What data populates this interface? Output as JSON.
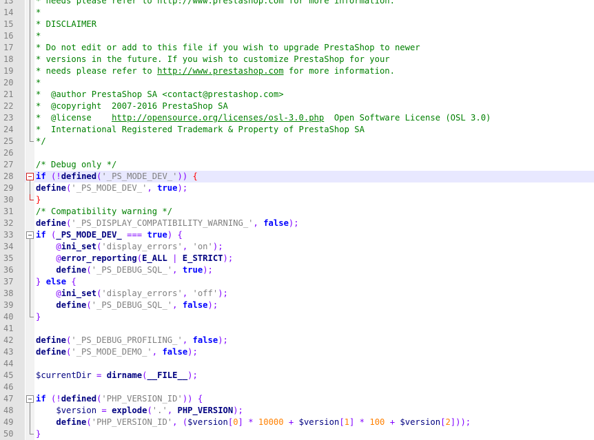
{
  "editor": {
    "current_line": "28",
    "lines": [
      {
        "num": "13",
        "fold": "v",
        "t": [
          [
            "c",
            "* needs please refer to http://www.prestashop.com for more information."
          ]
        ]
      },
      {
        "num": "14",
        "fold": "v",
        "t": [
          [
            "c",
            "*"
          ]
        ]
      },
      {
        "num": "15",
        "fold": "v",
        "t": [
          [
            "c",
            "* DISCLAIMER"
          ]
        ]
      },
      {
        "num": "16",
        "fold": "v",
        "t": [
          [
            "c",
            "*"
          ]
        ]
      },
      {
        "num": "17",
        "fold": "v",
        "t": [
          [
            "c",
            "* Do not edit or add to this file if you wish to upgrade PrestaShop to newer"
          ]
        ]
      },
      {
        "num": "18",
        "fold": "v",
        "t": [
          [
            "c",
            "* versions in the future. If you wish to customize PrestaShop for your"
          ]
        ]
      },
      {
        "num": "19",
        "fold": "v",
        "t": [
          [
            "c",
            "* needs please refer to "
          ],
          [
            "lnk",
            "http://www.prestashop.com"
          ],
          [
            "c",
            " for more information."
          ]
        ]
      },
      {
        "num": "20",
        "fold": "v",
        "t": [
          [
            "c",
            "*"
          ]
        ]
      },
      {
        "num": "21",
        "fold": "v",
        "t": [
          [
            "c",
            "*  @author PrestaShop SA <contact@prestashop.com>"
          ]
        ]
      },
      {
        "num": "22",
        "fold": "v",
        "t": [
          [
            "c",
            "*  @copyright  2007-2016 PrestaShop SA"
          ]
        ]
      },
      {
        "num": "23",
        "fold": "v",
        "t": [
          [
            "c",
            "*  @license    "
          ],
          [
            "lnk",
            "http://opensource.org/licenses/osl-3.0.php"
          ],
          [
            "c",
            "  Open Software License (OSL 3.0)"
          ]
        ]
      },
      {
        "num": "24",
        "fold": "v",
        "t": [
          [
            "c",
            "*  International Registered Trademark & Property of PrestaShop SA"
          ]
        ]
      },
      {
        "num": "25",
        "fold": "end",
        "t": [
          [
            "c",
            "*/"
          ]
        ]
      },
      {
        "num": "26",
        "fold": "",
        "t": []
      },
      {
        "num": "27",
        "fold": "",
        "t": [
          [
            "c",
            "/* Debug only */"
          ]
        ]
      },
      {
        "num": "28",
        "fold": "open-red",
        "t": [
          [
            "kw",
            "if"
          ],
          [
            "o",
            " ("
          ],
          [
            "o",
            "!"
          ],
          [
            "fn",
            "defined"
          ],
          [
            "o",
            "("
          ],
          [
            "s",
            "'_PS_MODE_DEV_'"
          ],
          [
            "o",
            "))"
          ],
          [
            "o",
            " "
          ],
          [
            "br",
            "{"
          ]
        ]
      },
      {
        "num": "29",
        "fold": "v-red",
        "t": [
          [
            "fn",
            "define"
          ],
          [
            "o",
            "("
          ],
          [
            "s",
            "'_PS_MODE_DEV_'"
          ],
          [
            "o",
            ", "
          ],
          [
            "kw",
            "true"
          ],
          [
            "o",
            ");"
          ]
        ]
      },
      {
        "num": "30",
        "fold": "end-red",
        "t": [
          [
            "br",
            "}"
          ]
        ]
      },
      {
        "num": "31",
        "fold": "",
        "t": [
          [
            "c",
            "/* Compatibility warning */"
          ]
        ]
      },
      {
        "num": "32",
        "fold": "",
        "t": [
          [
            "fn",
            "define"
          ],
          [
            "o",
            "("
          ],
          [
            "s",
            "'_PS_DISPLAY_COMPATIBILITY_WARNING_'"
          ],
          [
            "o",
            ", "
          ],
          [
            "kw",
            "false"
          ],
          [
            "o",
            ");"
          ]
        ]
      },
      {
        "num": "33",
        "fold": "open",
        "t": [
          [
            "kw",
            "if"
          ],
          [
            "o",
            " ("
          ],
          [
            "cst",
            "_PS_MODE_DEV_"
          ],
          [
            "o",
            " === "
          ],
          [
            "kw",
            "true"
          ],
          [
            "o",
            ") {"
          ]
        ]
      },
      {
        "num": "34",
        "fold": "v",
        "t": [
          [
            "o",
            "    @"
          ],
          [
            "fn",
            "ini_set"
          ],
          [
            "o",
            "("
          ],
          [
            "s",
            "'display_errors'"
          ],
          [
            "o",
            ", "
          ],
          [
            "s",
            "'on'"
          ],
          [
            "o",
            ");"
          ]
        ]
      },
      {
        "num": "35",
        "fold": "v",
        "t": [
          [
            "o",
            "    @"
          ],
          [
            "fn",
            "error_reporting"
          ],
          [
            "o",
            "("
          ],
          [
            "cst",
            "E_ALL"
          ],
          [
            "o",
            " | "
          ],
          [
            "cst",
            "E_STRICT"
          ],
          [
            "o",
            ");"
          ]
        ]
      },
      {
        "num": "36",
        "fold": "v",
        "t": [
          [
            "o",
            "    "
          ],
          [
            "fn",
            "define"
          ],
          [
            "o",
            "("
          ],
          [
            "s",
            "'_PS_DEBUG_SQL_'"
          ],
          [
            "o",
            ", "
          ],
          [
            "kw",
            "true"
          ],
          [
            "o",
            ");"
          ]
        ]
      },
      {
        "num": "37",
        "fold": "v",
        "t": [
          [
            "o",
            "} "
          ],
          [
            "kw",
            "else"
          ],
          [
            "o",
            " {"
          ]
        ]
      },
      {
        "num": "38",
        "fold": "v",
        "t": [
          [
            "o",
            "    @"
          ],
          [
            "fn",
            "ini_set"
          ],
          [
            "o",
            "("
          ],
          [
            "s",
            "'display_errors'"
          ],
          [
            "o",
            ", "
          ],
          [
            "s",
            "'off'"
          ],
          [
            "o",
            ");"
          ]
        ]
      },
      {
        "num": "39",
        "fold": "v",
        "t": [
          [
            "o",
            "    "
          ],
          [
            "fn",
            "define"
          ],
          [
            "o",
            "("
          ],
          [
            "s",
            "'_PS_DEBUG_SQL_'"
          ],
          [
            "o",
            ", "
          ],
          [
            "kw",
            "false"
          ],
          [
            "o",
            ");"
          ]
        ]
      },
      {
        "num": "40",
        "fold": "end",
        "t": [
          [
            "o",
            "}"
          ]
        ]
      },
      {
        "num": "41",
        "fold": "",
        "t": []
      },
      {
        "num": "42",
        "fold": "",
        "t": [
          [
            "fn",
            "define"
          ],
          [
            "o",
            "("
          ],
          [
            "s",
            "'_PS_DEBUG_PROFILING_'"
          ],
          [
            "o",
            ", "
          ],
          [
            "kw",
            "false"
          ],
          [
            "o",
            ");"
          ]
        ]
      },
      {
        "num": "43",
        "fold": "",
        "t": [
          [
            "fn",
            "define"
          ],
          [
            "o",
            "("
          ],
          [
            "s",
            "'_PS_MODE_DEMO_'"
          ],
          [
            "o",
            ", "
          ],
          [
            "kw",
            "false"
          ],
          [
            "o",
            ");"
          ]
        ]
      },
      {
        "num": "44",
        "fold": "",
        "t": []
      },
      {
        "num": "45",
        "fold": "",
        "t": [
          [
            "v",
            "$currentDir"
          ],
          [
            "o",
            " = "
          ],
          [
            "fn",
            "dirname"
          ],
          [
            "o",
            "("
          ],
          [
            "cst",
            "__FILE__"
          ],
          [
            "o",
            ");"
          ]
        ]
      },
      {
        "num": "46",
        "fold": "",
        "t": []
      },
      {
        "num": "47",
        "fold": "open",
        "t": [
          [
            "kw",
            "if"
          ],
          [
            "o",
            " (!"
          ],
          [
            "fn",
            "defined"
          ],
          [
            "o",
            "("
          ],
          [
            "s",
            "'PHP_VERSION_ID'"
          ],
          [
            "o",
            ")) {"
          ]
        ]
      },
      {
        "num": "48",
        "fold": "v",
        "t": [
          [
            "o",
            "    "
          ],
          [
            "v",
            "$version"
          ],
          [
            "o",
            " = "
          ],
          [
            "fn",
            "explode"
          ],
          [
            "o",
            "("
          ],
          [
            "s",
            "'.'"
          ],
          [
            "o",
            ", "
          ],
          [
            "cst",
            "PHP_VERSION"
          ],
          [
            "o",
            ");"
          ]
        ]
      },
      {
        "num": "49",
        "fold": "v",
        "t": [
          [
            "o",
            "    "
          ],
          [
            "fn",
            "define"
          ],
          [
            "o",
            "("
          ],
          [
            "s",
            "'PHP_VERSION_ID'"
          ],
          [
            "o",
            ", ("
          ],
          [
            "v",
            "$version"
          ],
          [
            "o",
            "["
          ],
          [
            "n",
            "0"
          ],
          [
            "o",
            "] * "
          ],
          [
            "n",
            "10000"
          ],
          [
            "o",
            " + "
          ],
          [
            "v",
            "$version"
          ],
          [
            "o",
            "["
          ],
          [
            "n",
            "1"
          ],
          [
            "o",
            "] * "
          ],
          [
            "n",
            "100"
          ],
          [
            "o",
            " + "
          ],
          [
            "v",
            "$version"
          ],
          [
            "o",
            "["
          ],
          [
            "n",
            "2"
          ],
          [
            "o",
            "]));"
          ]
        ]
      },
      {
        "num": "50",
        "fold": "end",
        "t": [
          [
            "o",
            "}"
          ]
        ]
      }
    ]
  }
}
